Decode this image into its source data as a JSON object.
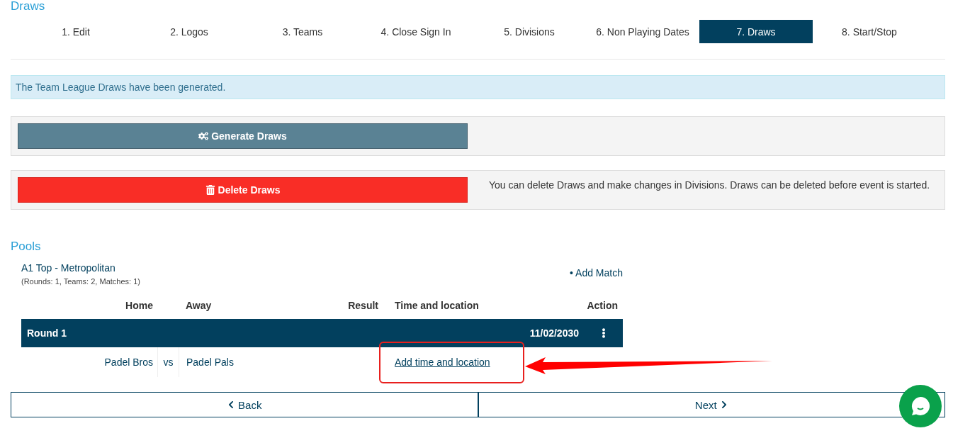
{
  "page_title": "Draws",
  "steps": [
    {
      "label": "1. Edit",
      "selected": false
    },
    {
      "label": "2. Logos",
      "selected": false
    },
    {
      "label": "3. Teams",
      "selected": false
    },
    {
      "label": "4. Close Sign In",
      "selected": false
    },
    {
      "label": "5. Divisions",
      "selected": false
    },
    {
      "label": "6. Non Playing Dates",
      "selected": false
    },
    {
      "label": "7. Draws",
      "selected": true
    },
    {
      "label": "8. Start/Stop",
      "selected": false
    }
  ],
  "alert": "The Team League Draws have been generated.",
  "generate_button": "Generate Draws",
  "delete_button": "Delete Draws",
  "delete_note": "You can delete Draws and make changes in Divisions. Draws can be deleted before event is started.",
  "pools": {
    "title": "Pools",
    "pool_name": "A1 Top - Metropolitan",
    "pool_stats": "(Rounds: 1, Teams: 2, Matches: 1)",
    "add_match": "• Add Match",
    "columns": [
      "Home",
      "Away",
      "Result",
      "Time and location",
      "Action"
    ],
    "rounds": [
      {
        "label": "Round 1",
        "date": "11/02/2030",
        "matches": [
          {
            "home": "Padel Bros",
            "vs": "vs",
            "away": "Padel Pals",
            "time_link": "Add time and location"
          }
        ]
      }
    ]
  },
  "nav": {
    "back": "Back",
    "next": "Next"
  }
}
